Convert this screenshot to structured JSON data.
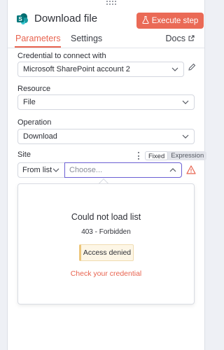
{
  "header": {
    "title": "Download file",
    "execute_label": "Execute step",
    "node_icon": "sharepoint-icon"
  },
  "tabs": [
    {
      "label": "Parameters",
      "active": true
    },
    {
      "label": "Settings",
      "active": false
    }
  ],
  "docs_label": "Docs",
  "fields": {
    "credential": {
      "label": "Credential to connect with",
      "value": "Microsoft SharePoint account 2"
    },
    "resource": {
      "label": "Resource",
      "value": "File"
    },
    "operation": {
      "label": "Operation",
      "value": "Download"
    },
    "site": {
      "label": "Site",
      "mode_value": "From list",
      "placeholder": "Choose...",
      "toggle_fixed": "Fixed",
      "toggle_expression": "Expression"
    }
  },
  "dropdown": {
    "title": "Could not load list",
    "code": "403 - Forbidden",
    "badge": "Access denied",
    "link": "Check your credential"
  },
  "colors": {
    "accent": "#ea6a56",
    "input_focus": "#6b5fd3",
    "warning_badge": "#fdf6e6"
  }
}
